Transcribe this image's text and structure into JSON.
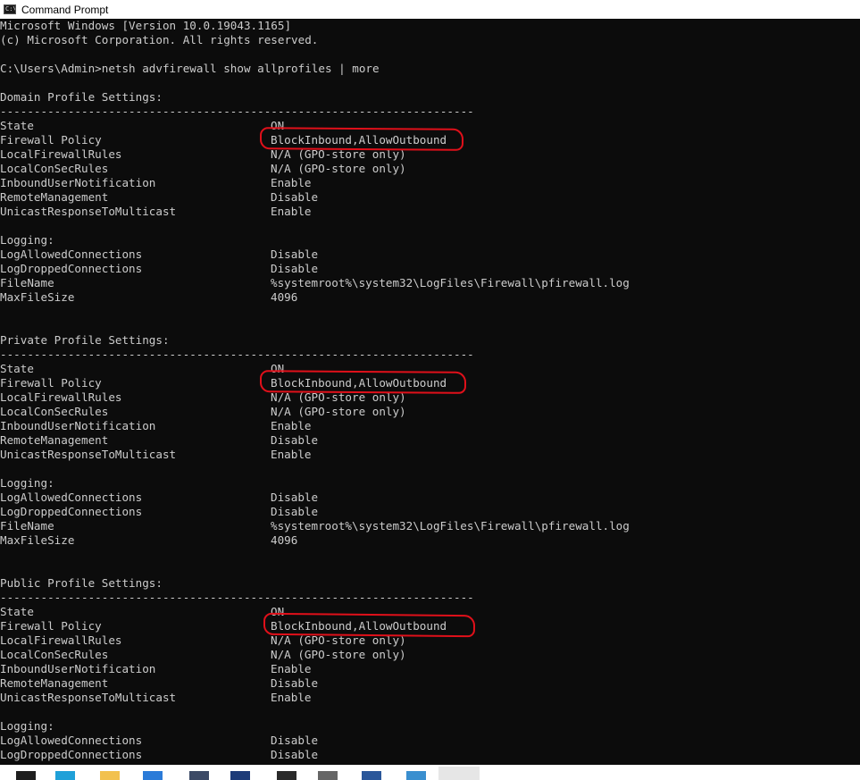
{
  "window": {
    "title": "Command Prompt"
  },
  "header_lines": [
    "Microsoft Windows [Version 10.0.19043.1165]",
    "(c) Microsoft Corporation. All rights reserved.",
    "",
    "C:\\Users\\Admin>netsh advfirewall show allprofiles | more"
  ],
  "separator": "----------------------------------------------------------------------",
  "profiles": [
    {
      "heading": "Domain Profile Settings:",
      "settings": [
        {
          "key": "State",
          "value": "ON"
        },
        {
          "key": "Firewall Policy",
          "value": "BlockInbound,AllowOutbound"
        },
        {
          "key": "LocalFirewallRules",
          "value": "N/A (GPO-store only)"
        },
        {
          "key": "LocalConSecRules",
          "value": "N/A (GPO-store only)"
        },
        {
          "key": "InboundUserNotification",
          "value": "Enable"
        },
        {
          "key": "RemoteManagement",
          "value": "Disable"
        },
        {
          "key": "UnicastResponseToMulticast",
          "value": "Enable"
        }
      ],
      "logging_heading": "Logging:",
      "logging": [
        {
          "key": "LogAllowedConnections",
          "value": "Disable"
        },
        {
          "key": "LogDroppedConnections",
          "value": "Disable"
        },
        {
          "key": "FileName",
          "value": "%systemroot%\\system32\\LogFiles\\Firewall\\pfirewall.log"
        },
        {
          "key": "MaxFileSize",
          "value": "4096"
        }
      ]
    },
    {
      "heading": "Private Profile Settings:",
      "settings": [
        {
          "key": "State",
          "value": "ON"
        },
        {
          "key": "Firewall Policy",
          "value": "BlockInbound,AllowOutbound"
        },
        {
          "key": "LocalFirewallRules",
          "value": "N/A (GPO-store only)"
        },
        {
          "key": "LocalConSecRules",
          "value": "N/A (GPO-store only)"
        },
        {
          "key": "InboundUserNotification",
          "value": "Enable"
        },
        {
          "key": "RemoteManagement",
          "value": "Disable"
        },
        {
          "key": "UnicastResponseToMulticast",
          "value": "Enable"
        }
      ],
      "logging_heading": "Logging:",
      "logging": [
        {
          "key": "LogAllowedConnections",
          "value": "Disable"
        },
        {
          "key": "LogDroppedConnections",
          "value": "Disable"
        },
        {
          "key": "FileName",
          "value": "%systemroot%\\system32\\LogFiles\\Firewall\\pfirewall.log"
        },
        {
          "key": "MaxFileSize",
          "value": "4096"
        }
      ]
    },
    {
      "heading": "Public Profile Settings:",
      "settings": [
        {
          "key": "State",
          "value": "ON"
        },
        {
          "key": "Firewall Policy",
          "value": "BlockInbound,AllowOutbound"
        },
        {
          "key": "LocalFirewallRules",
          "value": "N/A (GPO-store only)"
        },
        {
          "key": "LocalConSecRules",
          "value": "N/A (GPO-store only)"
        },
        {
          "key": "InboundUserNotification",
          "value": "Enable"
        },
        {
          "key": "RemoteManagement",
          "value": "Disable"
        },
        {
          "key": "UnicastResponseToMulticast",
          "value": "Enable"
        }
      ],
      "logging_heading": "Logging:",
      "logging": [
        {
          "key": "LogAllowedConnections",
          "value": "Disable"
        },
        {
          "key": "LogDroppedConnections",
          "value": "Disable"
        }
      ]
    }
  ],
  "colors": {
    "console_bg": "#0c0c0c",
    "console_text": "#cccccc",
    "annotation": "#e0101a"
  },
  "taskbar_icons": [
    "windows-start-icon",
    "edge-icon",
    "file-explorer-icon",
    "vscode-icon",
    "app-icon",
    "powershell-icon",
    "terminal-icon",
    "app-icon",
    "word-icon",
    "app-icon",
    "command-prompt-icon"
  ]
}
